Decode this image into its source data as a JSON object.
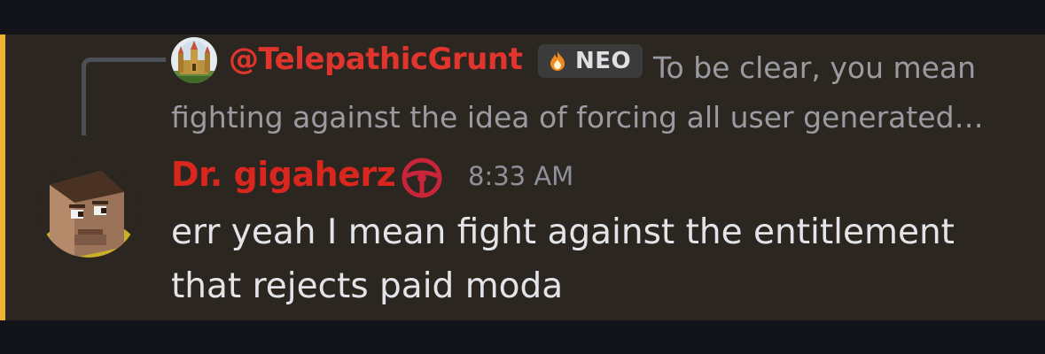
{
  "reply": {
    "author": "@TelepathicGrunt",
    "badge": "NEO",
    "snippet": "To be clear, you mean fighting against the idea of forcing all user generated content to be free"
  },
  "message": {
    "author": "Dr. gigaherz",
    "timestamp": "8:33 AM",
    "text": "err yeah I mean fight against the entitlement that rejects paid moda"
  },
  "icons": {
    "reply_avatar": "castle-avatar-icon",
    "badge_icon": "flame-icon",
    "role_icon": "steering-wheel-icon",
    "avatar": "pixel-face-avatar-icon"
  },
  "colors": {
    "page_background": "#121419",
    "message_background": "#2c2621",
    "mention_bar": "#f0b232",
    "reply_author": "#e0352d",
    "author": "#d9261e",
    "role_icon": "#c8243a",
    "text": "#e3e4e8",
    "muted": "#9a9ba1"
  }
}
